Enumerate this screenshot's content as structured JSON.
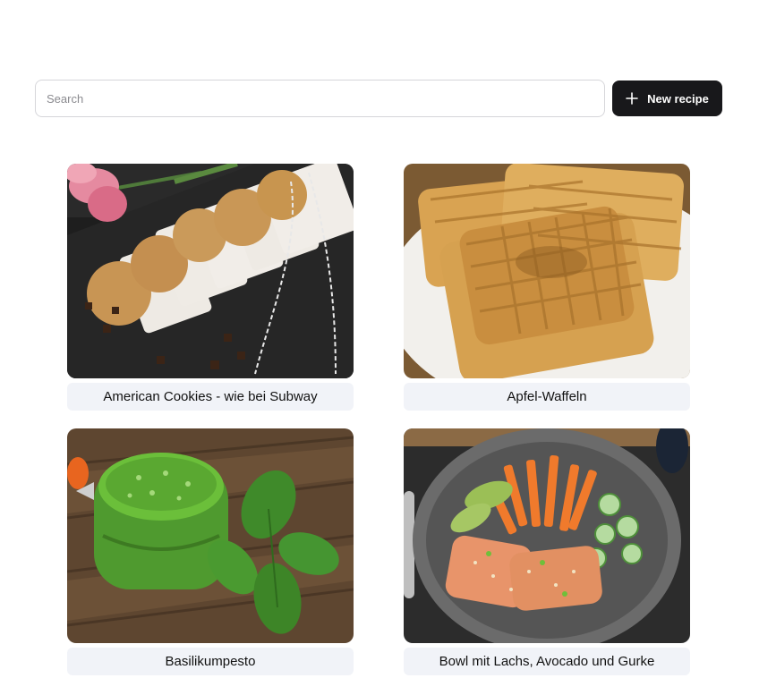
{
  "search": {
    "placeholder": "Search",
    "value": ""
  },
  "toolbar": {
    "new_recipe_label": "New recipe",
    "new_recipe_icon": "plus-icon"
  },
  "recipes": [
    {
      "title": "American Cookies - wie bei Subway"
    },
    {
      "title": "Apfel-Waffeln"
    },
    {
      "title": "Basilikumpesto"
    },
    {
      "title": "Bowl mit Lachs, Avocado und Gurke"
    }
  ]
}
